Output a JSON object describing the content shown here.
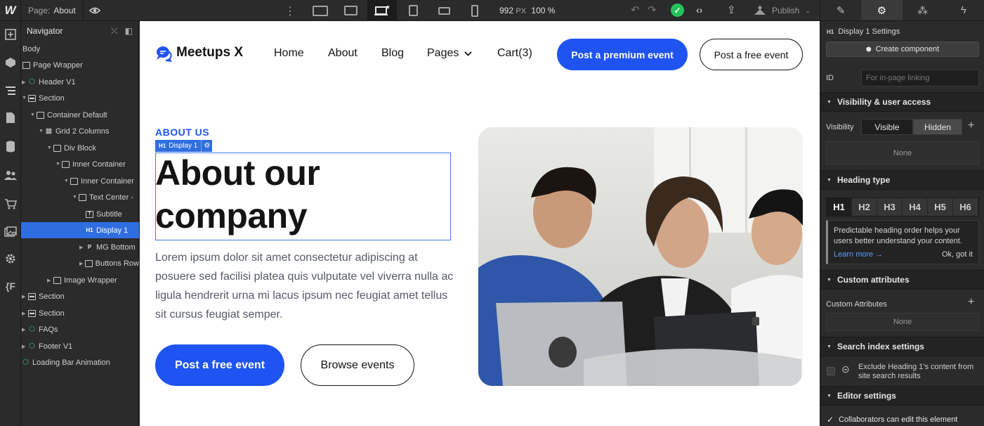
{
  "topbar": {
    "logo": "W",
    "page_label": "Page:",
    "page_value": "About",
    "zoom_px": "992",
    "zoom_unit": "PX",
    "zoom_pct": "100 %",
    "publish_label": "Publish"
  },
  "navigator": {
    "title": "Navigator",
    "items": [
      {
        "label": "Body"
      },
      {
        "label": "Page Wrapper"
      },
      {
        "label": "Header V1"
      },
      {
        "label": "Section"
      },
      {
        "label": "Container Default"
      },
      {
        "label": "Grid 2 Columns"
      },
      {
        "label": "Div Block"
      },
      {
        "label": "Inner Container"
      },
      {
        "label": "Inner Container"
      },
      {
        "label": "Text Center -"
      },
      {
        "label": "Subtitle"
      },
      {
        "label": "Display 1"
      },
      {
        "label": "MG Bottom"
      },
      {
        "label": "Buttons Row"
      },
      {
        "label": "Image Wrapper"
      },
      {
        "label": "Section"
      },
      {
        "label": "Section"
      },
      {
        "label": "FAQs"
      },
      {
        "label": "Footer V1"
      },
      {
        "label": "Loading Bar Animation"
      }
    ]
  },
  "site": {
    "brand": "Meetups X",
    "nav": [
      "Home",
      "About",
      "Blog",
      "Pages",
      "Cart(3)"
    ],
    "premium_button": "Post a premium event",
    "free_header_button": "Post a free event",
    "kicker": "ABOUT US",
    "element_tag": "H1",
    "element_tag_name": "Display 1",
    "title": "About our company",
    "paragraph": "Lorem ipsum dolor sit amet consectetur adipiscing at posuere sed facilisi platea quis vulputate vel viverra nulla ac ligula hendrerit urna mi lacus ipsum nec feugiat amet tellus sit cursus feugiat semper.",
    "primary_button": "Post a free event",
    "secondary_button": "Browse events"
  },
  "panel": {
    "header_tag": "H1",
    "header": "Display 1 Settings",
    "create_component": "Create component",
    "id_label": "ID",
    "id_placeholder": "For in-page linking",
    "visibility_section": "Visibility & user access",
    "visibility_label": "Visibility",
    "visible": "Visible",
    "hidden": "Hidden",
    "none1": "None",
    "heading_type_section": "Heading type",
    "heading_levels": [
      "H1",
      "H2",
      "H3",
      "H4",
      "H5",
      "H6"
    ],
    "hint_text": "Predictable heading order helps your users better understand your content.",
    "learn_more": "Learn more →",
    "ok_got_it": "Ok, got it",
    "custom_attr_section": "Custom attributes",
    "custom_attr_label": "Custom Attributes",
    "none2": "None",
    "search_index_section": "Search index settings",
    "exclude_text": "Exclude Heading 1's content from site search results",
    "editor_section": "Editor settings",
    "collab_text": "Collaborators can edit this element"
  }
}
